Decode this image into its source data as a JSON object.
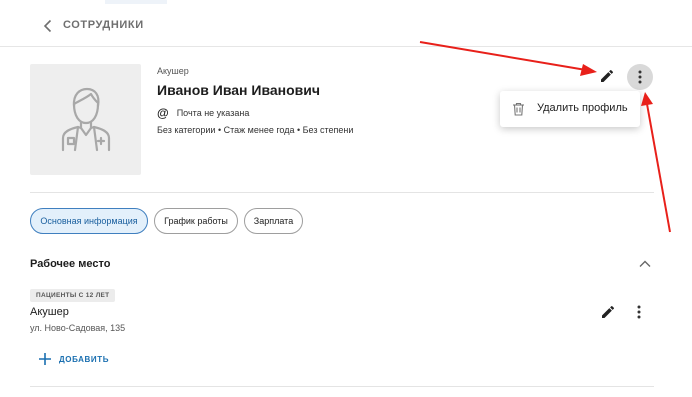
{
  "header": {
    "back_icon": "chevron-left-icon",
    "breadcrumb": "СОТРУДНИКИ"
  },
  "profile": {
    "avatar_icon": "doctor-avatar-icon",
    "role": "Акушер",
    "name": "Иванов Иван Иванович",
    "email_icon": "at-icon",
    "email": "Почта не указана",
    "meta": "Без категории • Стаж менее года • Без степени",
    "edit_icon": "pencil-icon",
    "more_icon": "more-vertical-icon"
  },
  "menu": {
    "delete_icon": "trash-icon",
    "delete_label": "Удалить профиль"
  },
  "tabs": [
    {
      "label": "Основная информация",
      "active": true
    },
    {
      "label": "График работы",
      "active": false
    },
    {
      "label": "Зарплата",
      "active": false
    }
  ],
  "workplace": {
    "title": "Рабочее место",
    "collapse_icon": "chevron-up-icon",
    "badge": "ПАЦИЕНТЫ С 12 ЛЕТ",
    "position": "Акушер",
    "address": "ул. Ново-Садовая, 135",
    "add_icon": "plus-icon",
    "add_label": "ДОБАВИТЬ"
  },
  "colors": {
    "accent": "#1a6fb0",
    "active_tab_bg": "#e3f0fb",
    "annotation_arrow": "#e8201a"
  }
}
